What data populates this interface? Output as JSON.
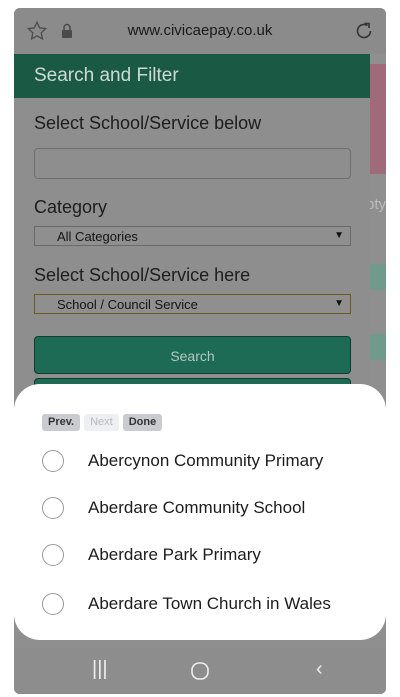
{
  "browser": {
    "url": "www.civicaepay.co.uk"
  },
  "panel": {
    "title": "Search and Filter",
    "school_label": "Select School/Service below",
    "school_input_value": "",
    "category_label": "Category",
    "category_selected": "All Categories",
    "service_label": "Select School/Service here",
    "service_selected": "School / Council Service",
    "search_button": "Search"
  },
  "background_fragment": "pty:",
  "picker": {
    "prev_label": "Prev.",
    "next_label": "Next",
    "done_label": "Done",
    "options": [
      "Abercynon Community Primary",
      "Aberdare Community School",
      "Aberdare Park Primary",
      "Aberdare Town Church in Wales"
    ]
  },
  "colors": {
    "header_green": "#1a5a45",
    "button_green": "#1d6a55",
    "background_pink": "#a06a7a"
  }
}
